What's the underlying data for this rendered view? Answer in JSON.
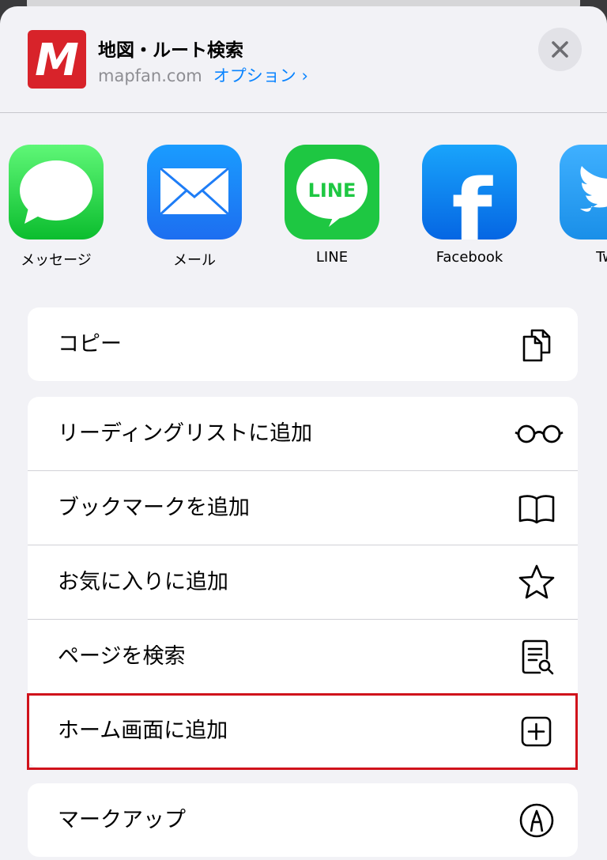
{
  "header": {
    "title": "地図・ルート検索",
    "domain": "mapfan.com",
    "options_label": "オプション",
    "app_icon_letter": "M",
    "brand_color": "#d8232a"
  },
  "share_apps": [
    {
      "label": "メッセージ",
      "icon": "messages-icon"
    },
    {
      "label": "メール",
      "icon": "mail-icon"
    },
    {
      "label": "LINE",
      "icon": "line-icon",
      "icon_text": "LINE"
    },
    {
      "label": "Facebook",
      "icon": "facebook-icon",
      "icon_text": "f"
    },
    {
      "label": "Twi",
      "icon": "twitter-icon"
    }
  ],
  "actions": {
    "copy": "コピー",
    "reading_list": "リーディングリストに追加",
    "bookmark": "ブックマークを追加",
    "favorites": "お気に入りに追加",
    "find_on_page": "ページを検索",
    "add_to_home": "ホーム画面に追加",
    "markup": "マークアップ"
  },
  "accent_color": "#0a84ff",
  "highlight_color": "#d0121b"
}
